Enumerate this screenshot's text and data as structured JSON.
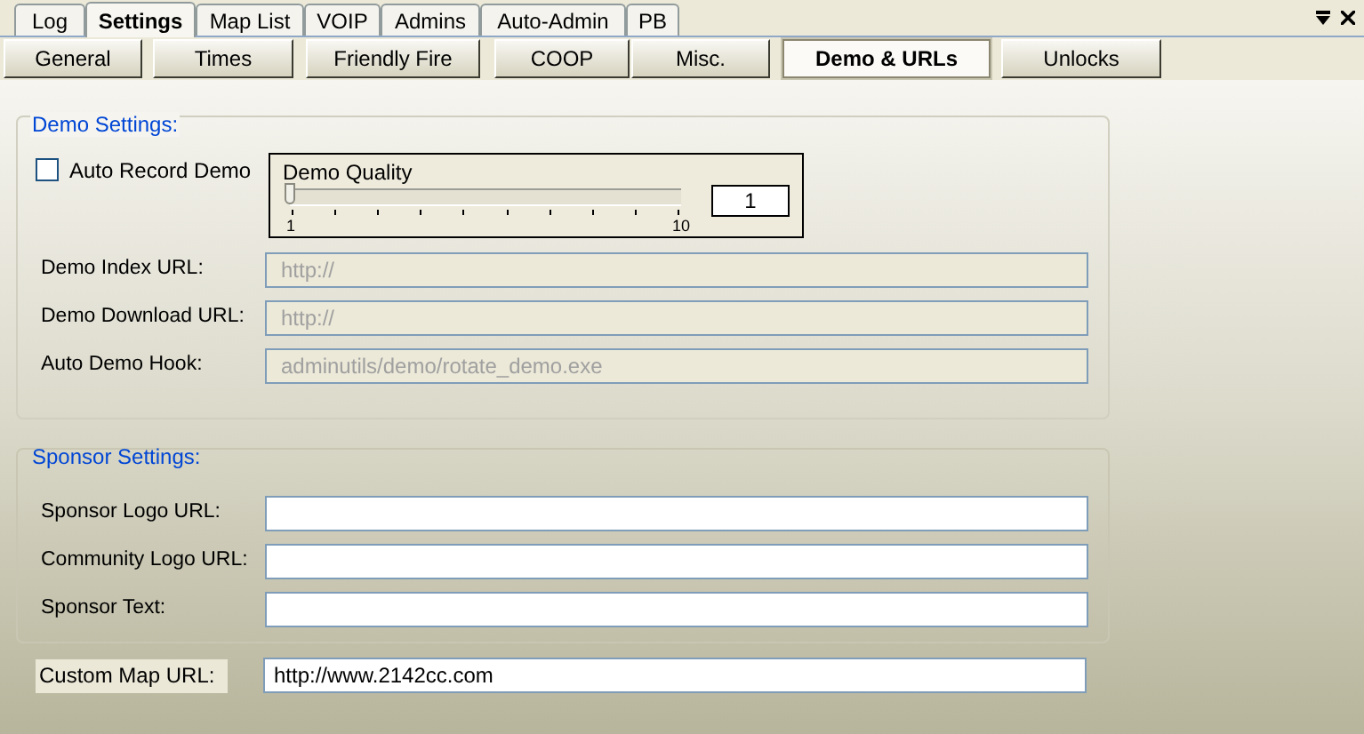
{
  "tabs": [
    {
      "label": "Log",
      "selected": false
    },
    {
      "label": "Settings",
      "selected": true
    },
    {
      "label": "Map List",
      "selected": false
    },
    {
      "label": "VOIP",
      "selected": false
    },
    {
      "label": "Admins",
      "selected": false
    },
    {
      "label": "Auto-Admin",
      "selected": false
    },
    {
      "label": "PB",
      "selected": false
    }
  ],
  "subtabs": [
    {
      "label": "General",
      "selected": false
    },
    {
      "label": "Times",
      "selected": false
    },
    {
      "label": "Friendly Fire",
      "selected": false
    },
    {
      "label": "COOP",
      "selected": false
    },
    {
      "label": "Misc.",
      "selected": false
    },
    {
      "label": "Demo & URLs",
      "selected": true
    },
    {
      "label": "Unlocks",
      "selected": false
    }
  ],
  "demo_settings": {
    "title": "Demo Settings:",
    "auto_record": {
      "label": "Auto Record Demo",
      "checked": false
    },
    "quality": {
      "title": "Demo Quality",
      "level": 0,
      "min_label": "1",
      "max_label": "10",
      "value": "1"
    },
    "fields": [
      {
        "label": "Demo Index URL:",
        "value": "http://",
        "disabled": true
      },
      {
        "label": "Demo Download URL:",
        "value": "http://",
        "disabled": true
      },
      {
        "label": "Auto Demo Hook:",
        "value": "adminutils/demo/rotate_demo.exe",
        "disabled": true
      }
    ]
  },
  "sponsor_settings": {
    "title": "Sponsor Settings:",
    "fields": [
      {
        "label": "Sponsor Logo URL:",
        "disabled": false
      },
      {
        "label": "Community Logo URL:",
        "disabled": false
      },
      {
        "label": "Sponsor Text:",
        "disabled": false
      }
    ]
  },
  "custom_map": {
    "label": "Custom Map URL:",
    "value": "http://www.2142cc.com"
  }
}
